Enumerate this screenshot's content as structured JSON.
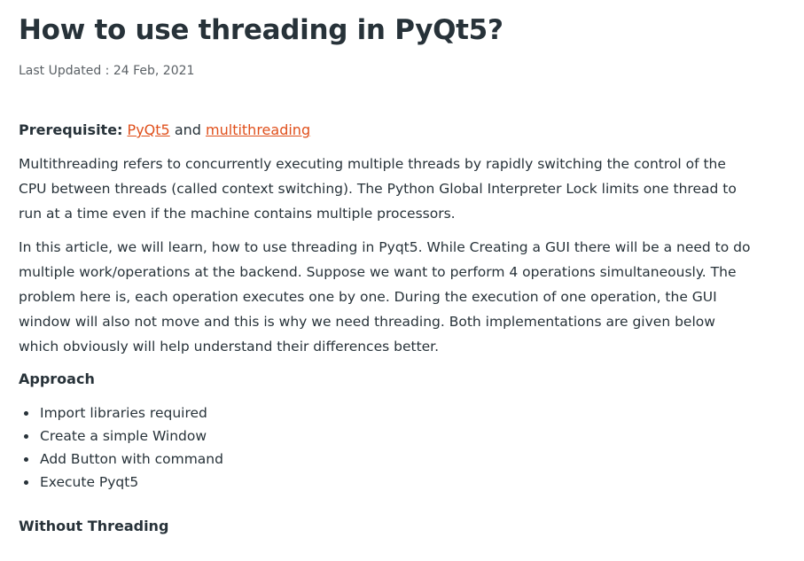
{
  "article": {
    "title": "How to use threading in PyQt5?",
    "last_updated_label": "Last Updated : ",
    "last_updated_date": "24 Feb, 2021",
    "prerequisite": {
      "label": "Prerequisite:",
      "link1": "PyQt5",
      "connector": "and",
      "link2": "multithreading"
    },
    "paragraphs": [
      "Multithreading refers to concurrently executing multiple threads by rapidly switching the control of the CPU between threads (called context switching). The Python Global Interpreter Lock limits one thread to run at a time even if the machine contains multiple processors.",
      "In this article, we will learn, how to use threading in Pyqt5. While Creating a GUI there will be a need to do multiple work/operations at the backend. Suppose we want to perform 4 operations simultaneously. The problem here is, each operation executes one by one. During the execution of one operation, the GUI window will also not move and this is why we need threading. Both implementations are given below which obviously will help understand their differences better."
    ],
    "approach_heading": "Approach",
    "approach_steps": [
      "Import libraries required",
      "Create a simple Window",
      "Add Button with command",
      "Execute Pyqt5"
    ],
    "without_threading_heading": "Without Threading"
  },
  "colors": {
    "text": "#273239",
    "link": "#e0501c",
    "muted": "#5b6166"
  }
}
